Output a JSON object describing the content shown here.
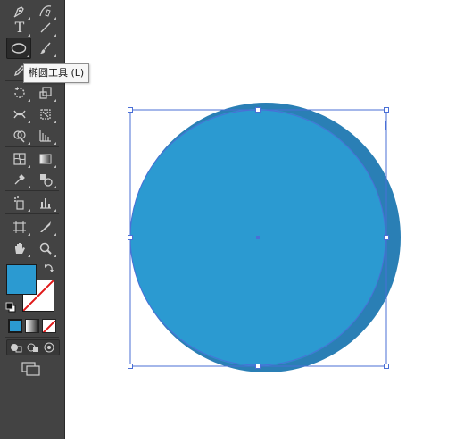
{
  "tooltip": {
    "text": "椭圆工具 (L)"
  },
  "toolbar": {
    "tools": [
      {
        "name": "pen-tool",
        "icon": "pen-icon"
      },
      {
        "name": "curvature-tool",
        "icon": "curvature-pen-icon"
      },
      {
        "name": "type-tool",
        "icon": "type-icon",
        "glyph": "T"
      },
      {
        "name": "line-segment-tool",
        "icon": "line-icon"
      },
      {
        "name": "ellipse-tool",
        "icon": "ellipse-icon",
        "active": true
      },
      {
        "name": "paintbrush-tool",
        "icon": "brush-icon"
      },
      {
        "name": "pencil-tool",
        "icon": "pencil-icon"
      },
      {
        "name": "rotate-tool",
        "icon": "rotate-icon"
      },
      {
        "name": "scale-tool",
        "icon": "scale-icon"
      },
      {
        "name": "width-tool",
        "icon": "width-icon"
      },
      {
        "name": "free-transform-tool",
        "icon": "free-transform-icon"
      },
      {
        "name": "shape-builder-tool",
        "icon": "shape-builder-icon"
      },
      {
        "name": "perspective-grid-tool",
        "icon": "perspective-grid-icon"
      },
      {
        "name": "mesh-tool",
        "icon": "mesh-icon"
      },
      {
        "name": "gradient-tool",
        "icon": "gradient-icon"
      },
      {
        "name": "eyedropper-tool",
        "icon": "eyedropper-icon"
      },
      {
        "name": "blend-tool",
        "icon": "blend-icon"
      },
      {
        "name": "symbol-sprayer-tool",
        "icon": "symbol-sprayer-icon"
      },
      {
        "name": "column-graph-tool",
        "icon": "column-graph-icon"
      },
      {
        "name": "artboard-tool",
        "icon": "artboard-icon"
      },
      {
        "name": "slice-tool",
        "icon": "slice-icon"
      },
      {
        "name": "hand-tool",
        "icon": "hand-icon"
      },
      {
        "name": "zoom-tool",
        "icon": "zoom-icon"
      }
    ]
  },
  "colors": {
    "fill": "#2b9ad1",
    "ellipse_fill": "#2b9ad1",
    "ellipse_shadow": "#2a7fb5",
    "selection": "#4a6fd6",
    "toolbar_bg": "#434343"
  }
}
